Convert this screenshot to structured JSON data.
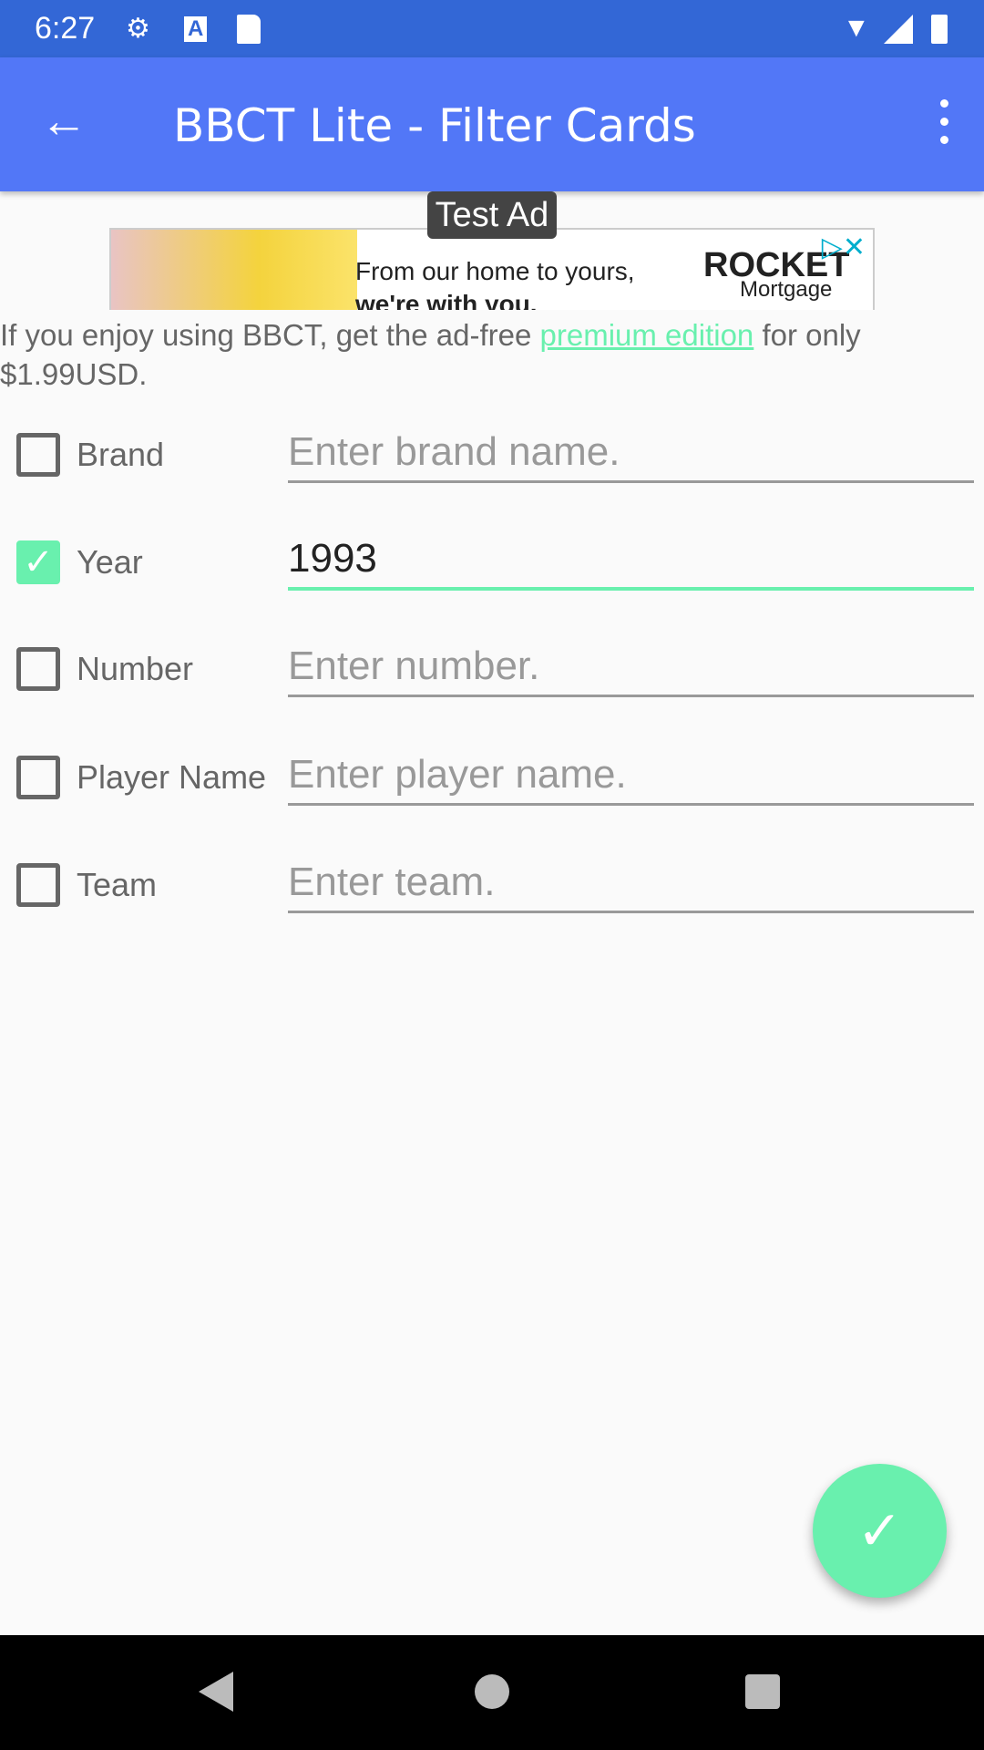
{
  "status_bar": {
    "time": "6:27",
    "icons": [
      "gear-icon",
      "a-icon",
      "sd-card-icon",
      "wifi-icon",
      "signal-icon",
      "battery-icon"
    ]
  },
  "app_bar": {
    "title": "BBCT Lite - Filter Cards",
    "back_icon": "arrow-back-icon",
    "menu_icon": "more-vert-icon"
  },
  "ad": {
    "label": "Test Ad",
    "headline": "From our home to yours,",
    "headline2": "we're with you.",
    "brand": "ROCKET",
    "brand_sub": "Mortgage"
  },
  "promo": {
    "before": "If you enjoy using BBCT, get the ad-free ",
    "link": "premium edition",
    "after": " for only $1.99USD."
  },
  "filters": [
    {
      "label": "Brand",
      "checked": false,
      "value": "",
      "placeholder": "Enter brand name."
    },
    {
      "label": "Year",
      "checked": true,
      "value": "1993",
      "placeholder": ""
    },
    {
      "label": "Number",
      "checked": false,
      "value": "",
      "placeholder": "Enter number."
    },
    {
      "label": "Player Name",
      "checked": false,
      "value": "",
      "placeholder": "Enter player name."
    },
    {
      "label": "Team",
      "checked": false,
      "value": "",
      "placeholder": "Enter team."
    }
  ],
  "fab": {
    "icon": "check-icon"
  },
  "colors": {
    "status": "#3367d6",
    "app_bar": "#5277f7",
    "accent": "#69f0ae"
  }
}
